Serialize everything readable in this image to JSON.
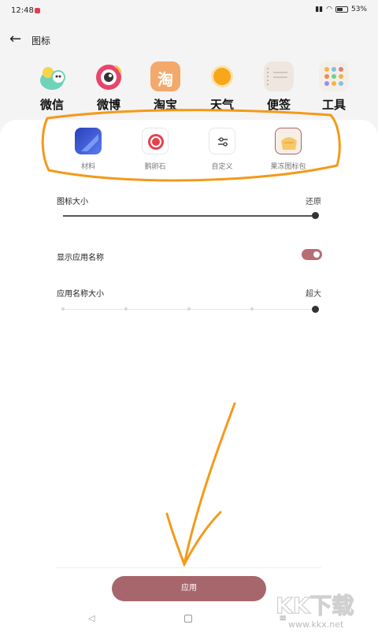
{
  "status_bar": {
    "time": "12:48",
    "battery": "53%"
  },
  "header": {
    "title": "图标"
  },
  "apps": [
    {
      "label": "微信",
      "icon": "wechat-frog-icon"
    },
    {
      "label": "微博",
      "icon": "weibo-icon"
    },
    {
      "label": "淘宝",
      "icon": "taobao-icon",
      "glyph": "淘"
    },
    {
      "label": "天气",
      "icon": "weather-sun-icon"
    },
    {
      "label": "便签",
      "icon": "notes-icon"
    },
    {
      "label": "工具",
      "icon": "tools-icon"
    }
  ],
  "icon_styles": [
    {
      "label": "材料",
      "icon": "material-style-icon"
    },
    {
      "label": "鹅卵石",
      "icon": "pebble-style-icon"
    },
    {
      "label": "自定义",
      "icon": "custom-sliders-icon"
    },
    {
      "label": "果冻图标包",
      "icon": "jelly-pack-icon"
    }
  ],
  "settings": {
    "icon_size": {
      "label": "图标大小",
      "reset": "还原",
      "value": 1.0
    },
    "show_app_name": {
      "label": "显示应用名称",
      "enabled": true
    },
    "app_name_size": {
      "label": "应用名称大小",
      "value_label": "超大",
      "level": 5,
      "max_level": 5
    }
  },
  "apply_button": {
    "label": "应用"
  },
  "colors": {
    "accent": "#a7666c",
    "annotation": "#f39a1a"
  },
  "watermark": {
    "brand": "KK下载",
    "url": "www.kkx.net"
  }
}
